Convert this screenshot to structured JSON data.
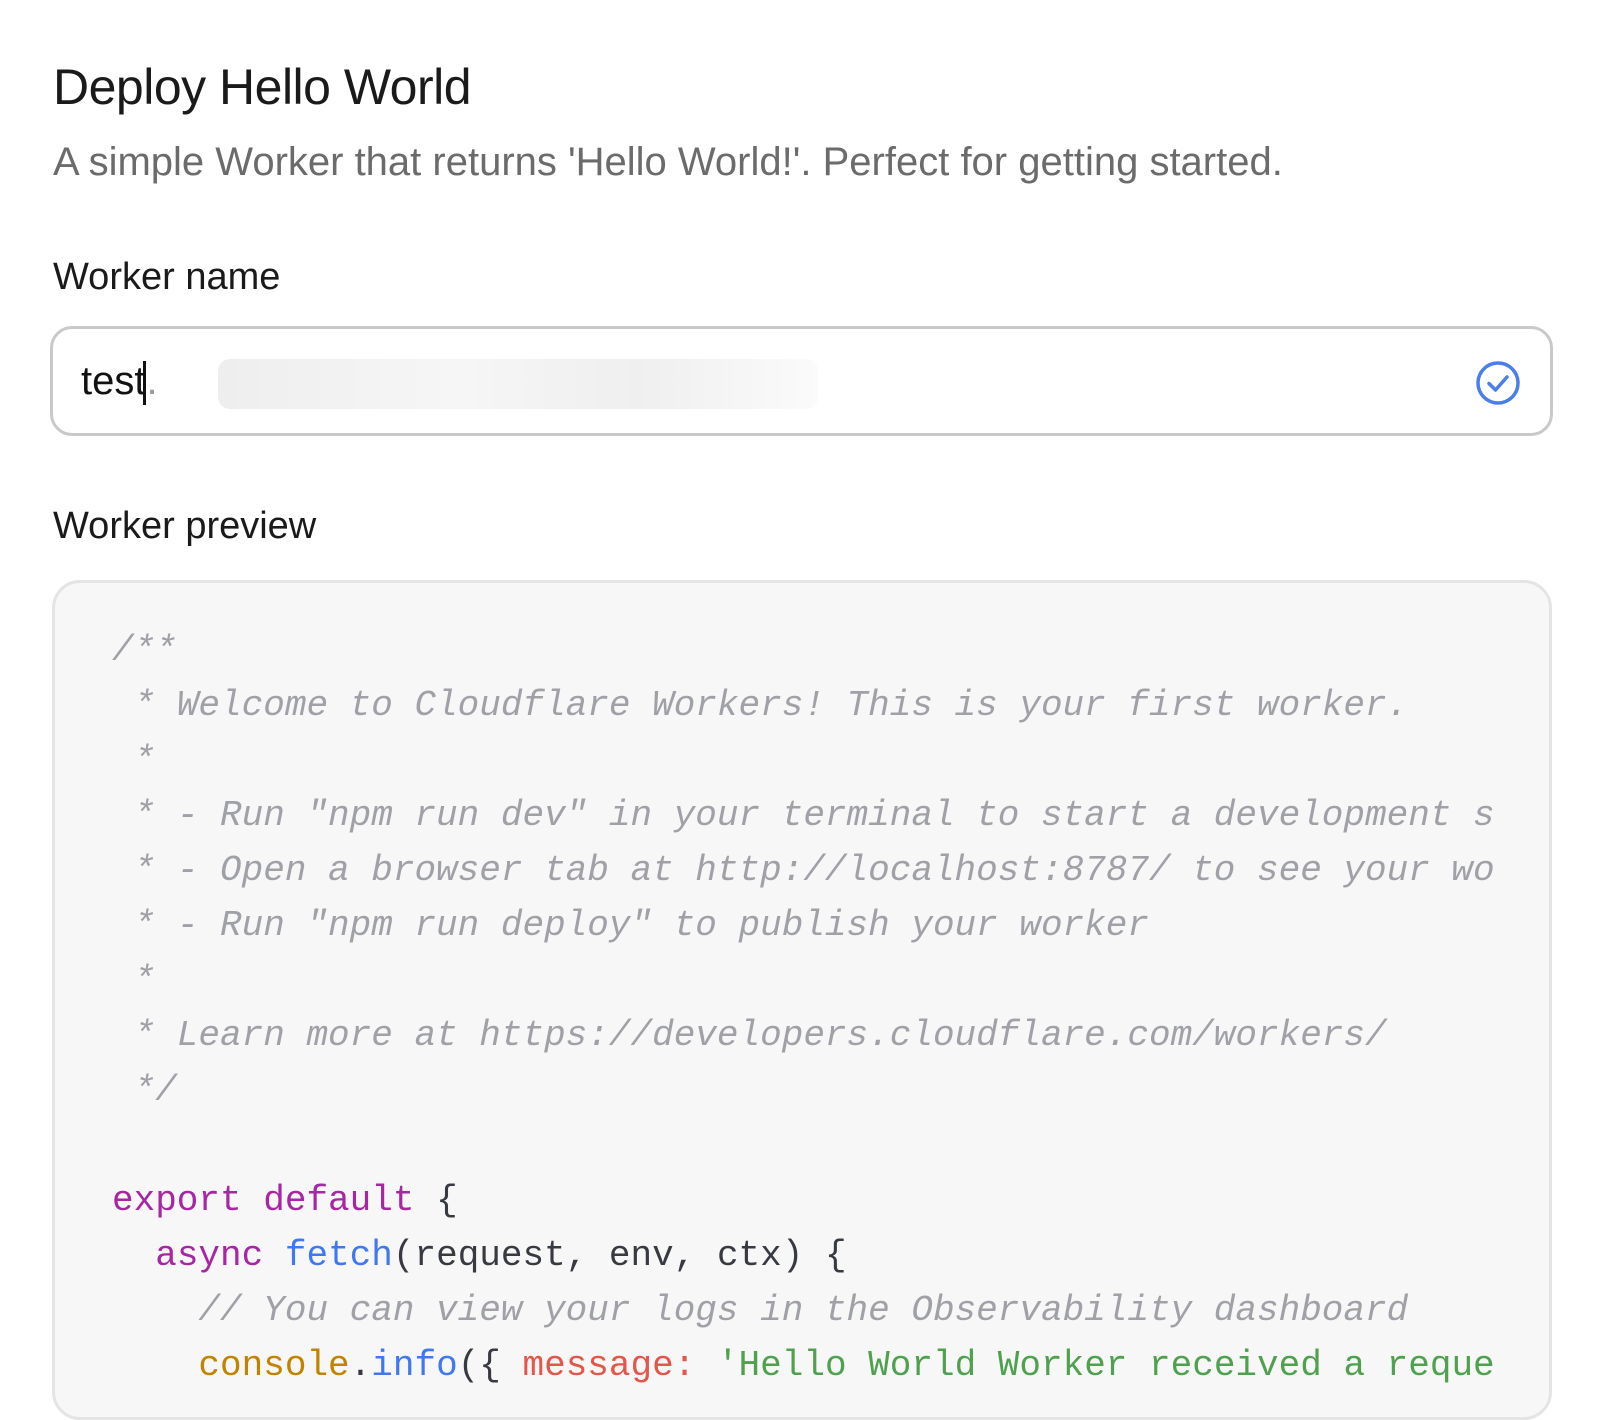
{
  "header": {
    "title": "Deploy Hello World",
    "subtitle": "A simple Worker that returns 'Hello World!'. Perfect for getting started."
  },
  "worker_name": {
    "label": "Worker name",
    "value": "test",
    "suffix": ".",
    "valid_icon": "check-circle-icon",
    "valid_color": "#4a7ee8"
  },
  "preview": {
    "label": "Worker preview",
    "code_lines": [
      {
        "indent": "",
        "tokens": [
          {
            "t": "cm",
            "v": "/**"
          }
        ]
      },
      {
        "indent": " ",
        "tokens": [
          {
            "t": "cm",
            "v": "* Welcome to Cloudflare Workers! This is your first worker."
          }
        ]
      },
      {
        "indent": " ",
        "tokens": [
          {
            "t": "cm",
            "v": "*"
          }
        ]
      },
      {
        "indent": " ",
        "tokens": [
          {
            "t": "cm",
            "v": "* - Run \"npm run dev\" in your terminal to start a development s"
          }
        ]
      },
      {
        "indent": " ",
        "tokens": [
          {
            "t": "cm",
            "v": "* - Open a browser tab at http://localhost:8787/ to see your wo"
          }
        ]
      },
      {
        "indent": " ",
        "tokens": [
          {
            "t": "cm",
            "v": "* - Run \"npm run deploy\" to publish your worker"
          }
        ]
      },
      {
        "indent": " ",
        "tokens": [
          {
            "t": "cm",
            "v": "*"
          }
        ]
      },
      {
        "indent": " ",
        "tokens": [
          {
            "t": "cm",
            "v": "* Learn more at https://developers.cloudflare.com/workers/"
          }
        ]
      },
      {
        "indent": " ",
        "tokens": [
          {
            "t": "cm",
            "v": "*/"
          }
        ]
      },
      {
        "indent": "",
        "tokens": []
      },
      {
        "indent": "",
        "tokens": [
          {
            "t": "kw",
            "v": "export"
          },
          {
            "t": "pl",
            "v": " "
          },
          {
            "t": "kw",
            "v": "default"
          },
          {
            "t": "pl",
            "v": " {"
          }
        ]
      },
      {
        "indent": "  ",
        "tokens": [
          {
            "t": "kw",
            "v": "async"
          },
          {
            "t": "pl",
            "v": " "
          },
          {
            "t": "fn",
            "v": "fetch"
          },
          {
            "t": "pl",
            "v": "(request, env, ctx) {"
          }
        ]
      },
      {
        "indent": "    ",
        "tokens": [
          {
            "t": "cm",
            "v": "// You can view your logs in the Observability dashboard"
          }
        ]
      },
      {
        "indent": "    ",
        "tokens": [
          {
            "t": "obj",
            "v": "console"
          },
          {
            "t": "pl",
            "v": "."
          },
          {
            "t": "fn",
            "v": "info"
          },
          {
            "t": "pl",
            "v": "({ "
          },
          {
            "t": "prop",
            "v": "message:"
          },
          {
            "t": "pl",
            "v": " "
          },
          {
            "t": "str",
            "v": "'Hello World Worker received a reque"
          }
        ]
      }
    ]
  }
}
